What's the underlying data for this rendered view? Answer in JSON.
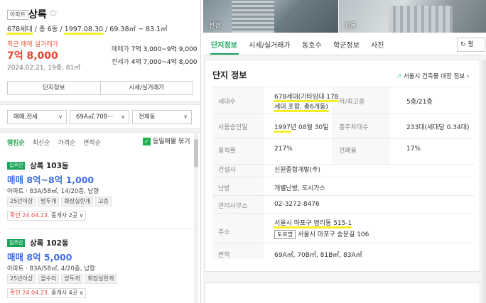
{
  "complex": {
    "type_badge": "아파트",
    "name": "상록",
    "meta_households": "678세대",
    "meta_floors": " / 총 6동 / ",
    "meta_date": "1997.08.30",
    "meta_area": " / 69.38㎡ ~ 83.1㎡",
    "recent_label": "최근 매매 실거래가",
    "recent_price": "7억 8,000",
    "recent_date": "2024.02.21, 19층, 81㎡",
    "sale_label": "매매가",
    "sale_range": "7억 3,000~9억 9,000",
    "rent_label": "전세가",
    "rent_range": "4억 7,000~4억 8,000",
    "btn_info": "단지정보",
    "btn_price": "시세/실거래가"
  },
  "filters": {
    "trade": "매매,전세",
    "area": "69A㎡,708···",
    "dong": "전체동"
  },
  "sort": {
    "items": [
      "랭킹순",
      "최신순",
      "가격순",
      "면적순"
    ],
    "same_listing": "동일매물 묶기"
  },
  "listings": [
    {
      "badge": "집주인",
      "name": "상록 103동",
      "price": "매매 8억~8억 1,000",
      "detail": "아파트 · 83A/58㎡, 14/20층, 남향",
      "tags": [
        "25년이상",
        "방두개",
        "화장실한개",
        "고층"
      ],
      "confirm_date": "확인 24.04.23.",
      "agency": "중개사 2곳"
    },
    {
      "badge": "집주인",
      "name": "상록 102동",
      "price": "매매 8억 5,000",
      "detail": "아파트 · 83A/58㎡, 4/20층, 남향",
      "tags": [
        "25년이상",
        "올수리",
        "방두개",
        "화장실한개"
      ],
      "confirm_date": "확인 24.04.23.",
      "agency": "중개사 4곳"
    }
  ],
  "photos": {
    "left_label": "전경",
    "right_label": "정문"
  },
  "tabs": [
    "단지정보",
    "시세/실거래가",
    "동호수",
    "학군정보",
    "사진"
  ],
  "pyeong_button": "평",
  "info": {
    "title": "단지 정보",
    "link": "서울시 건축물 대장 정보",
    "households_label": "세대수",
    "households_line1": "678세대(기타임대 178",
    "households_line2": "세대 포함, 총6개동)",
    "floors_label": "저/최고층",
    "floors_value": "5층/21층",
    "approval_label": "사용승인일",
    "approval_year": "1997",
    "approval_rest": "년 08월 30일",
    "parking_label": "총주차대수",
    "parking_value": "233대(세대당 0.34대)",
    "far_label": "용적률",
    "far_value": "217%",
    "bcr_label": "건폐율",
    "bcr_value": "17%",
    "builder_label": "건설사",
    "builder_value": "신원종합개발(주)",
    "heating_label": "난방",
    "heating_value": "개별난방, 도시가스",
    "office_label": "관리사무소",
    "office_value": "02-3272-8476",
    "address_label": "주소",
    "address_lot": "서울시 마포구 염리동 515-1",
    "road_tag": "도로명",
    "address_road": "서울시 마포구 숭문길 106",
    "area_label": "면적",
    "area_value": "69A㎡, 70B㎡, 81B㎡, 83A㎡"
  },
  "colors": {
    "accent_green": "#19a45a",
    "price_red": "#e8412c",
    "price_blue": "#3e6ee0",
    "highlight_yellow": "#f6ee2b"
  }
}
